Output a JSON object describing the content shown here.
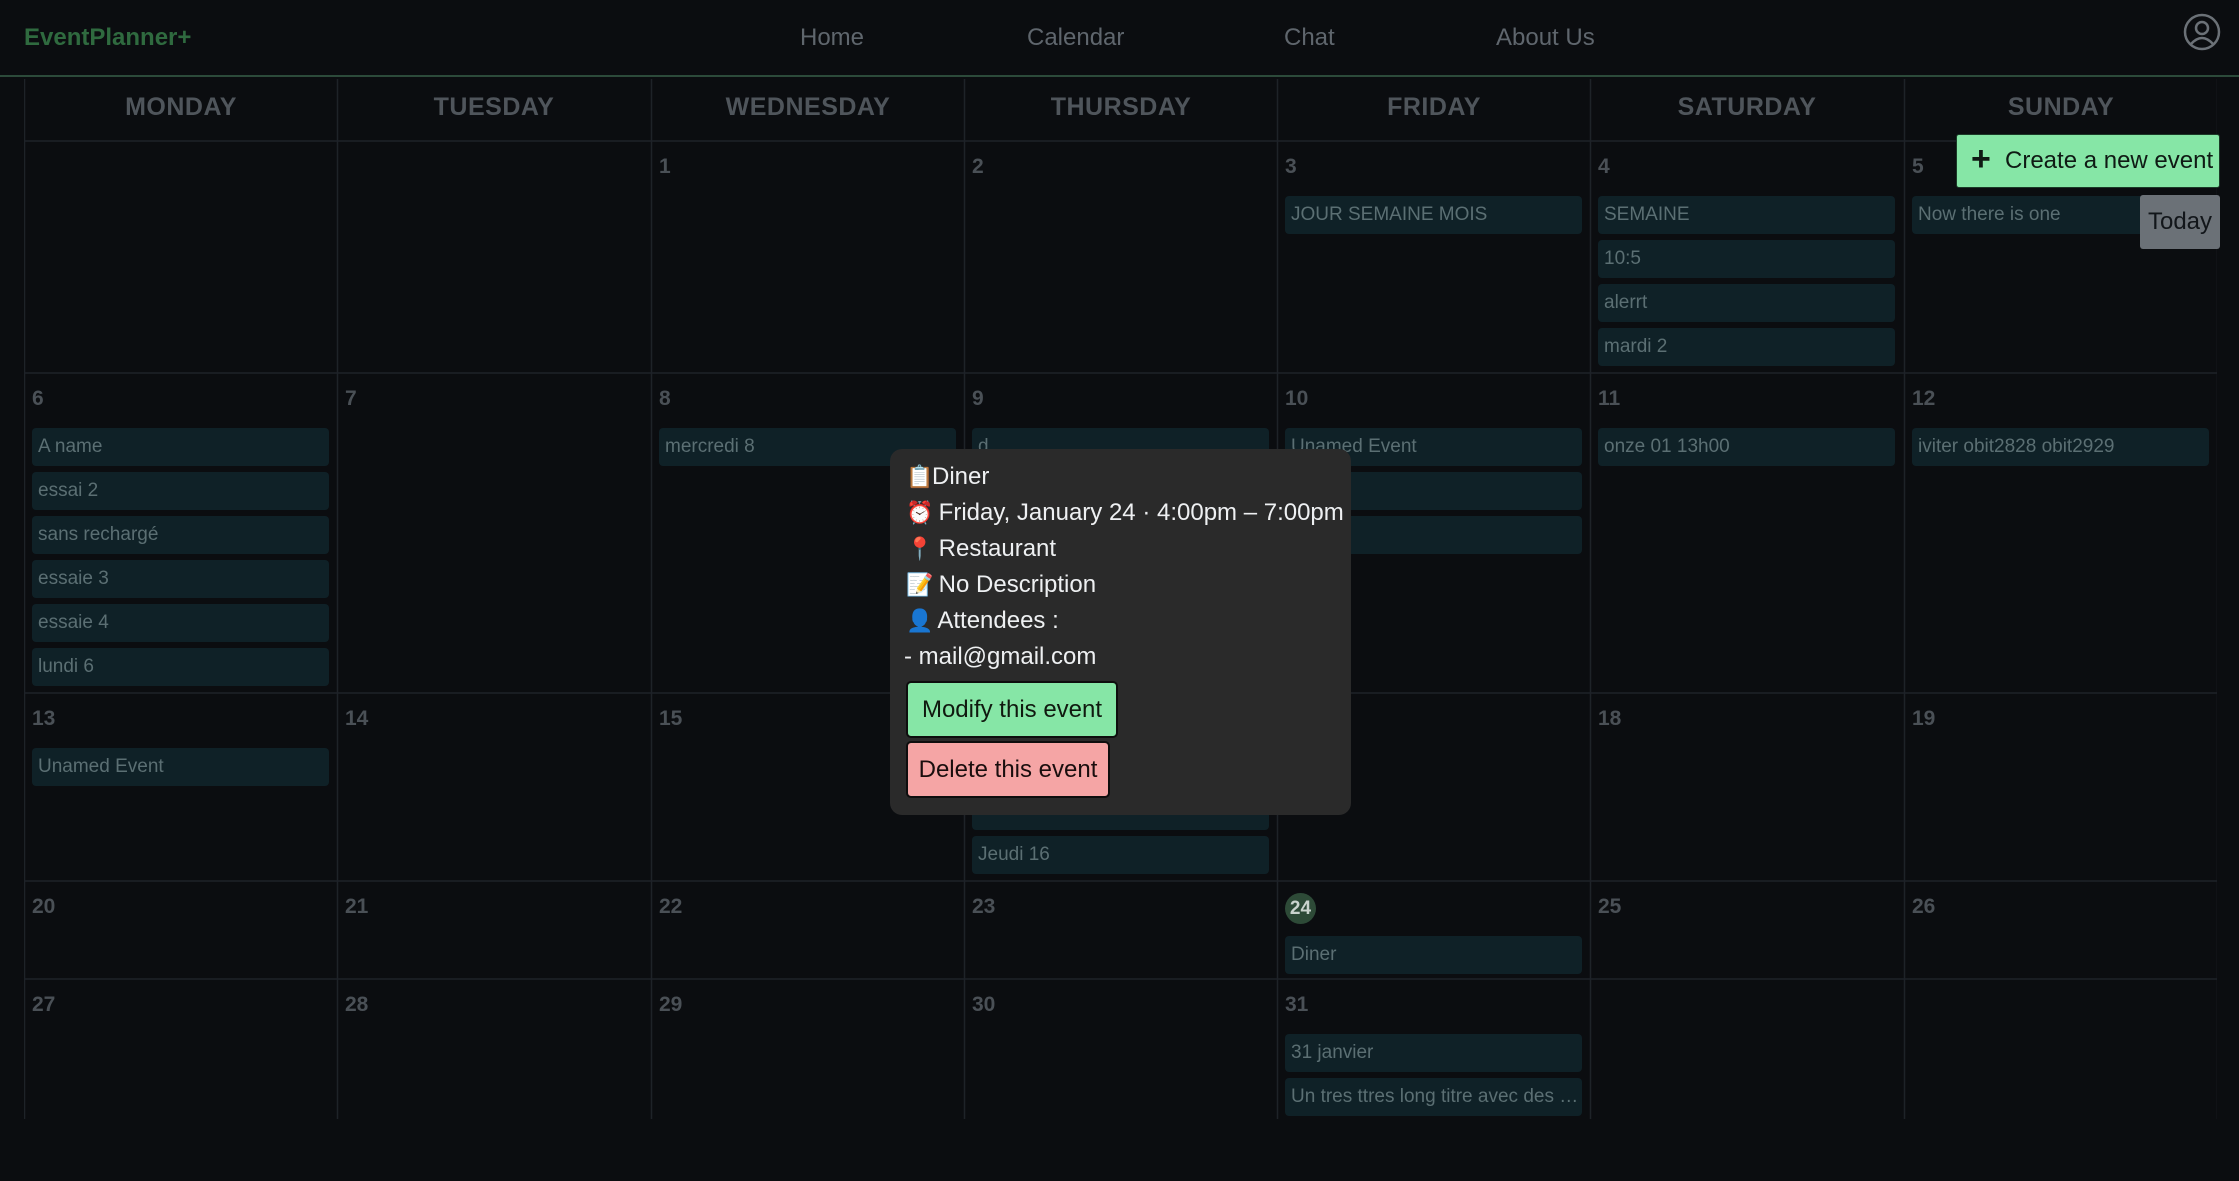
{
  "navbar": {
    "brand": "EventPlanner+",
    "links": [
      "Home",
      "Calendar",
      "Chat",
      "About Us"
    ],
    "profile_icon": "user-circle-icon"
  },
  "calendar": {
    "weekdays": [
      "MONDAY",
      "TUESDAY",
      "WEDNESDAY",
      "THURSDAY",
      "FRIDAY",
      "SATURDAY",
      "SUNDAY"
    ],
    "weeks": [
      [
        {
          "day": "",
          "events": []
        },
        {
          "day": "",
          "events": []
        },
        {
          "day": "1",
          "events": []
        },
        {
          "day": "2",
          "events": []
        },
        {
          "day": "3",
          "events": [
            "JOUR SEMAINE MOIS"
          ]
        },
        {
          "day": "4",
          "events": [
            "SEMAINE",
            "10:5",
            "alerrt",
            "mardi 2"
          ]
        },
        {
          "day": "5",
          "events": [
            "Now there is one"
          ]
        }
      ],
      [
        {
          "day": "6",
          "events": [
            "A name",
            "essai 2",
            "sans rechargé",
            "essaie 3",
            "essaie 4",
            "lundi 6"
          ]
        },
        {
          "day": "7",
          "events": []
        },
        {
          "day": "8",
          "events": [
            "mercredi 8"
          ]
        },
        {
          "day": "9",
          "events": [
            "d"
          ]
        },
        {
          "day": "10",
          "events": [
            "Unamed Event",
            "",
            ""
          ]
        },
        {
          "day": "11",
          "events": [
            "onze 01 13h00"
          ]
        },
        {
          "day": "12",
          "events": [
            "iviter obit2828 obit2929"
          ]
        }
      ],
      [
        {
          "day": "13",
          "events": [
            "Unamed Event"
          ]
        },
        {
          "day": "14",
          "events": []
        },
        {
          "day": "15",
          "events": []
        },
        {
          "day": "",
          "events": [
            "",
            "",
            "Jeudi 16"
          ]
        },
        {
          "day": "",
          "events": []
        },
        {
          "day": "18",
          "events": []
        },
        {
          "day": "19",
          "events": []
        }
      ],
      [
        {
          "day": "20",
          "events": []
        },
        {
          "day": "21",
          "events": []
        },
        {
          "day": "22",
          "events": []
        },
        {
          "day": "23",
          "events": []
        },
        {
          "day": "24",
          "today": true,
          "events": [
            "Diner"
          ]
        },
        {
          "day": "25",
          "events": []
        },
        {
          "day": "26",
          "events": []
        }
      ],
      [
        {
          "day": "27",
          "events": []
        },
        {
          "day": "28",
          "events": []
        },
        {
          "day": "29",
          "events": []
        },
        {
          "day": "30",
          "events": []
        },
        {
          "day": "31",
          "events": [
            "31 janvier",
            "Un tres ttres long titre avec des espaces"
          ]
        },
        {
          "day": "",
          "events": []
        },
        {
          "day": "",
          "events": []
        }
      ]
    ]
  },
  "actions": {
    "create_label": "Create a new event",
    "create_icon": "plus-icon",
    "today_label": "Today"
  },
  "popup": {
    "title_icon": "📋",
    "title": "Diner",
    "time_icon": "⏰",
    "time": "Friday, January 24 · 4:00pm – 7:00pm",
    "location_icon": "📍",
    "location": "Restaurant",
    "description_icon": "📝",
    "description": "No Description",
    "attendees_icon": "👤",
    "attendees_label": "Attendees :",
    "attendees": [
      "- mail@gmail.com"
    ],
    "modify_label": "Modify this event",
    "delete_label": "Delete this event"
  },
  "colors": {
    "background": "#0b0d10",
    "brand": "#2f6a3f",
    "event_bg": "#0f2127",
    "create_button": "#86e6a6",
    "delete_button": "#f5a5a5",
    "popup_bg": "#2a2a2a"
  }
}
